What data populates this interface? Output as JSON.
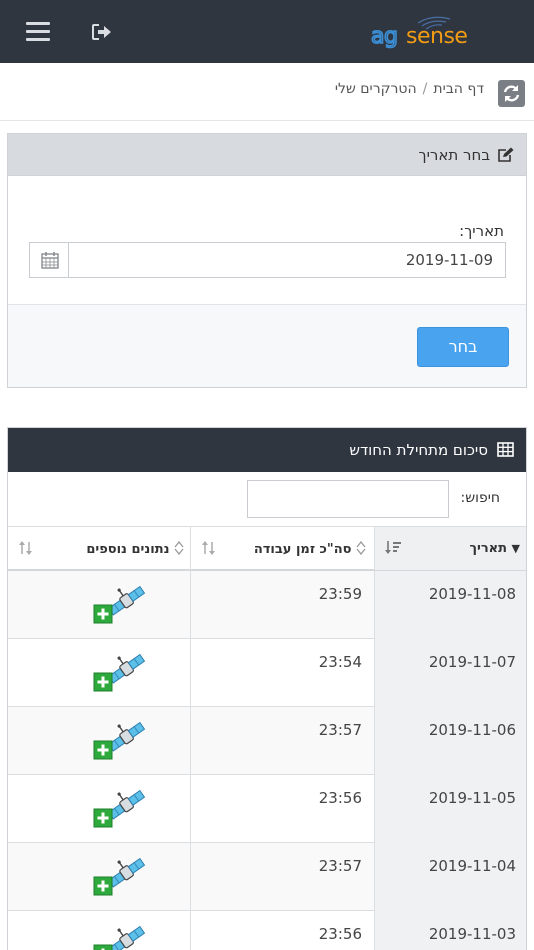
{
  "topbar": {
    "menu_icon": "hamburger-icon",
    "logout_icon": "sign-out-icon",
    "logo_text": "agsense",
    "colors": {
      "bg": "#2f3640",
      "logo_blue": "#3b8fd6",
      "logo_orange": "#f39c12"
    }
  },
  "breadcrumb": {
    "home": "דף הבית",
    "separator": "/",
    "current": "הטרקרים שלי",
    "refresh_icon": "refresh-icon"
  },
  "date_panel": {
    "title": "בחר תאריך",
    "title_icon": "edit-icon",
    "field_label": "תאריך:",
    "date_value": "2019-11-09",
    "calendar_icon": "calendar-icon",
    "submit_label": "בחר",
    "accent": "#4aa3ee"
  },
  "summary_panel": {
    "title": "סיכום מתחילת החודש",
    "title_icon": "table-icon",
    "search_label": "חיפוש:",
    "search_value": "",
    "columns": [
      {
        "key": "date",
        "label": "תאריך"
      },
      {
        "key": "total",
        "label": "סה\"כ זמן עבודה"
      },
      {
        "key": "extra",
        "label": "נתונים נוספים"
      }
    ],
    "rows": [
      {
        "date": "2019-11-08",
        "total": "23:59"
      },
      {
        "date": "2019-11-07",
        "total": "23:54"
      },
      {
        "date": "2019-11-06",
        "total": "23:57"
      },
      {
        "date": "2019-11-05",
        "total": "23:56"
      },
      {
        "date": "2019-11-04",
        "total": "23:57"
      },
      {
        "date": "2019-11-03",
        "total": "23:56"
      }
    ],
    "row_action_icon": "satellite-plus-icon"
  }
}
